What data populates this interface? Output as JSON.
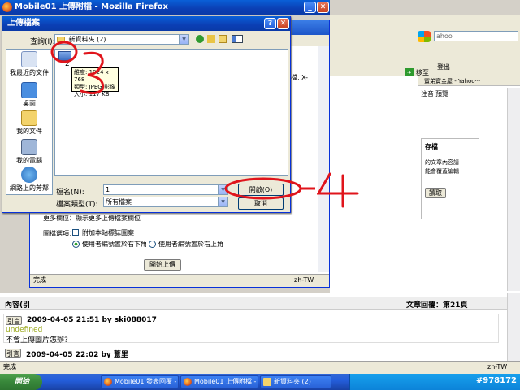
{
  "back_browser": {
    "title": "Mobile01 上傳附檔 - Mozilla Firefox",
    "search_placeholder": "ahoo",
    "logout": "登出",
    "bookmark": "寶弟寶金屋 - Yahoo···",
    "go_label": "移至",
    "text_x": "圖檔, X-",
    "note_label": "注音",
    "preview_label": "預覽",
    "panel_title": "存檔",
    "panel_line1": "的文章內容請",
    "panel_line2": "能會覆蓋編輯",
    "retrieve_button": "讀取"
  },
  "upload_page": {
    "more_fields": "更多欄位：顯示更多上傳檔案欄位",
    "options_label": "圖檔選項：",
    "watermark_checkbox": "附加本站標誌圖案",
    "radio_bottom_right": "使用者編號置於右下角",
    "radio_top_right": "使用者編號置於右上角",
    "start_upload_button": "開始上傳",
    "status_done": "完成",
    "status_lang": "zh-TW"
  },
  "forum": {
    "content_label": "內容(引",
    "article_reply_label": "文章回覆：第21頁",
    "quote_label": "引言",
    "post1_meta": "2009-04-05 21:51 by ski088017",
    "post1_sub": "undefined",
    "post1_text": "不會上傳圖片怎辦?",
    "post2_meta": "2009-04-05 22:02 by 薏里",
    "status_done": "完成",
    "status_lang": "zh-TW"
  },
  "dialog": {
    "title": "上傳檔案",
    "look_in_label": "查詢(I):",
    "look_in_value": "新資料夾 (2)",
    "places": [
      {
        "label": "我最近的文件"
      },
      {
        "label": "桌面"
      },
      {
        "label": "我的文件"
      },
      {
        "label": "我的電腦"
      },
      {
        "label": "網路上的芳鄰"
      }
    ],
    "file_item_name": "2",
    "tooltip": {
      "line1": "維度: 1024 x 768",
      "line2": "類型: JPEG 影像",
      "line3": "大小: 117 KB"
    },
    "file_name_label": "檔名(N):",
    "file_name_value": "1",
    "file_type_label": "檔案類型(T):",
    "file_type_value": "所有檔案",
    "open_button": "開啟(O)",
    "cancel_button": "取消"
  },
  "annotations": {
    "num3": "3",
    "num4": "4"
  },
  "taskbar": {
    "start": "開始",
    "tasks": [
      {
        "label": "Mobile01 發表回覆 - ..."
      },
      {
        "label": "Mobile01 上傳附檔 - ..."
      },
      {
        "label": "新資料夾 (2)"
      }
    ],
    "watermark": "#978172"
  }
}
